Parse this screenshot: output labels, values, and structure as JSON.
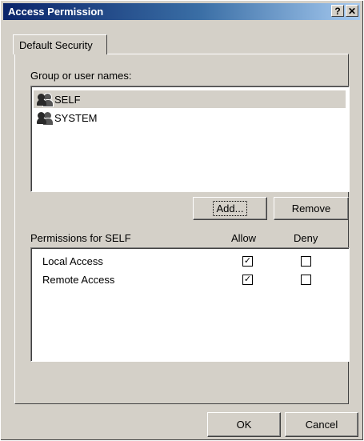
{
  "window": {
    "title": "Access Permission",
    "help_label": "?",
    "close_label": "✕"
  },
  "tabs": [
    {
      "label": "Default Security"
    }
  ],
  "groups": {
    "label": "Group or user names:",
    "items": [
      {
        "name": "SELF",
        "selected": true,
        "icon": "user-group-icon"
      },
      {
        "name": "SYSTEM",
        "selected": false,
        "icon": "user-group-icon"
      }
    ]
  },
  "buttons": {
    "add": "Add...",
    "remove": "Remove",
    "ok": "OK",
    "cancel": "Cancel"
  },
  "permissions": {
    "label": "Permissions for SELF",
    "allow_header": "Allow",
    "deny_header": "Deny",
    "items": [
      {
        "name": "Local Access",
        "allow": true,
        "deny": false
      },
      {
        "name": "Remote Access",
        "allow": true,
        "deny": false
      }
    ]
  },
  "colors": {
    "face": "#d4d0c8",
    "title_start": "#0a246a",
    "title_end": "#a6caf0"
  }
}
